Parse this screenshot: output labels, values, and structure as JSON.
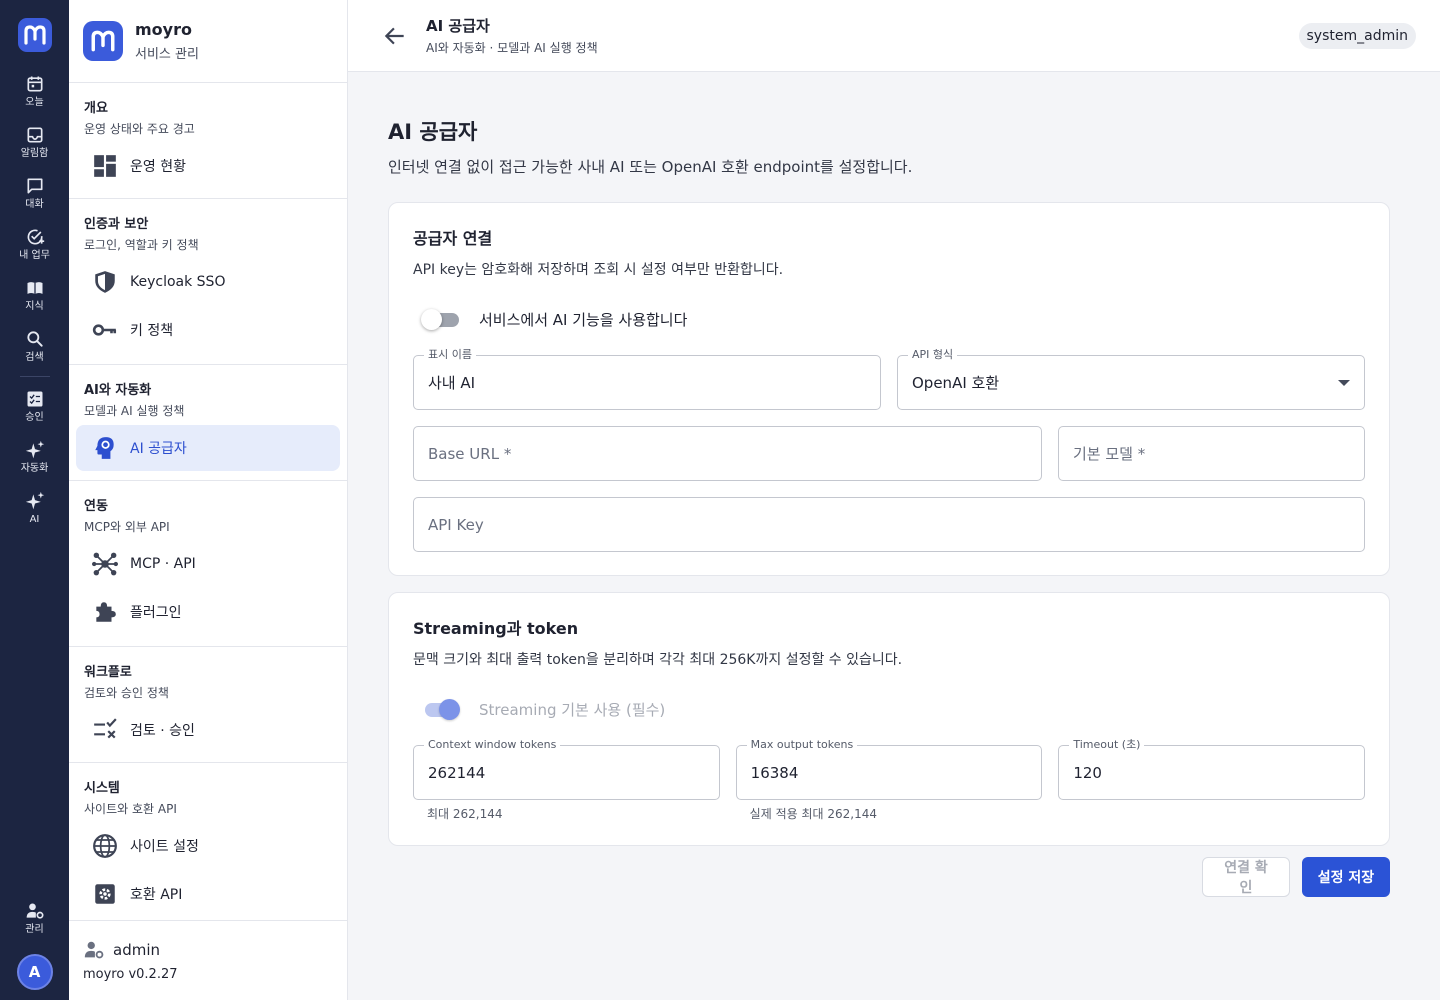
{
  "rail": {
    "items": [
      {
        "label": "오늘",
        "icon": "calendar-icon"
      },
      {
        "label": "알림함",
        "icon": "inbox-icon"
      },
      {
        "label": "대화",
        "icon": "chat-icon"
      },
      {
        "label": "내 업무",
        "icon": "task-check-icon"
      },
      {
        "label": "지식",
        "icon": "book-icon"
      },
      {
        "label": "검색",
        "icon": "search-icon"
      },
      {
        "label": "승인",
        "icon": "approval-icon"
      },
      {
        "label": "자동화",
        "icon": "sparkle-icon"
      },
      {
        "label": "AI",
        "icon": "sparkle-icon"
      }
    ],
    "admin_label": "관리",
    "avatar_initial": "A"
  },
  "brand": {
    "name": "moyro",
    "subtitle": "서비스 관리"
  },
  "sidebar": {
    "groups": [
      {
        "title": "개요",
        "subtitle": "운영 상태와 주요 경고",
        "items": [
          {
            "label": "운영 현황",
            "icon": "dashboard-icon"
          }
        ]
      },
      {
        "title": "인증과 보안",
        "subtitle": "로그인, 역할과 키 정책",
        "items": [
          {
            "label": "Keycloak SSO",
            "icon": "shield-icon"
          },
          {
            "label": "키 정책",
            "icon": "key-icon"
          }
        ]
      },
      {
        "title": "AI와 자동화",
        "subtitle": "모델과 AI 실행 정책",
        "items": [
          {
            "label": "AI 공급자",
            "icon": "ai-head-icon",
            "active": true
          }
        ]
      },
      {
        "title": "연동",
        "subtitle": "MCP와 외부 API",
        "items": [
          {
            "label": "MCP · API",
            "icon": "hub-icon"
          },
          {
            "label": "플러그인",
            "icon": "puzzle-icon"
          }
        ]
      },
      {
        "title": "워크플로",
        "subtitle": "검토와 승인 정책",
        "items": [
          {
            "label": "검토 · 승인",
            "icon": "checklist-icon"
          }
        ]
      },
      {
        "title": "시스템",
        "subtitle": "사이트와 호환 API",
        "items": [
          {
            "label": "사이트 설정",
            "icon": "globe-icon"
          },
          {
            "label": "호환 API",
            "icon": "settings-box-icon"
          }
        ]
      }
    ],
    "footer": {
      "user": "admin",
      "version": "moyro v0.2.27"
    }
  },
  "header": {
    "title": "AI 공급자",
    "subtitle": "AI와 자동화 · 모델과 AI 실행 정책",
    "role": "system_admin"
  },
  "page": {
    "title": "AI 공급자",
    "description": "인터넷 연결 없이 접근 가능한 사내 AI 또는 OpenAI 호환 endpoint를 설정합니다."
  },
  "provider_card": {
    "title": "공급자 연결",
    "description": "API key는 암호화해 저장하며 조회 시 설정 여부만 반환합니다.",
    "enable_toggle": {
      "label": "서비스에서 AI 기능을 사용합니다",
      "on": false
    },
    "display_name": {
      "label": "표시 이름",
      "value": "사내 AI"
    },
    "api_format": {
      "label": "API 형식",
      "value": "OpenAI 호환"
    },
    "base_url": {
      "placeholder": "Base URL *"
    },
    "default_model": {
      "placeholder": "기본 모델 *"
    },
    "api_key": {
      "placeholder": "API Key"
    }
  },
  "streaming_card": {
    "title": "Streaming과 token",
    "description": "문맥 크기와 최대 출력 token을 분리하며 각각 최대 256K까지 설정할 수 있습니다.",
    "streaming_toggle": {
      "label": "Streaming 기본 사용 (필수)",
      "on": true,
      "disabled": true
    },
    "context_window": {
      "label": "Context window tokens",
      "value": "262144",
      "helper": "최대 262,144"
    },
    "max_output": {
      "label": "Max output tokens",
      "value": "16384",
      "helper": "실제 적용 최대 262,144"
    },
    "timeout": {
      "label": "Timeout (초)",
      "value": "120"
    }
  },
  "actions": {
    "test_label": "연결 확인",
    "save_label": "설정 저장"
  },
  "colors": {
    "rail_bg": "#1c2541",
    "accent": "#2b53d6",
    "active_bg": "#e6ecfb"
  }
}
